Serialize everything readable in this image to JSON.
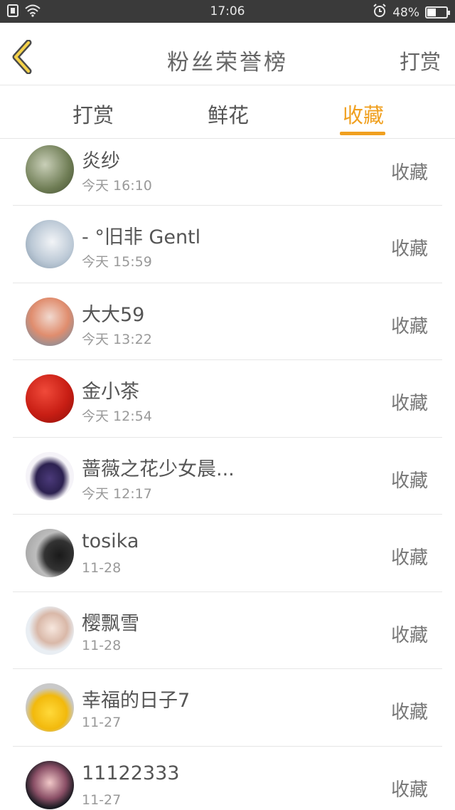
{
  "status_bar": {
    "time": "17:06",
    "battery": "48%",
    "battery_level": 0.48
  },
  "header": {
    "title": "粉丝荣誉榜",
    "action": "打赏"
  },
  "tabs": [
    {
      "label": "打赏"
    },
    {
      "label": "鲜花"
    },
    {
      "label": "收藏"
    }
  ],
  "list": [
    {
      "name": "炎纱",
      "time": "今天 16:10",
      "tag": "收藏"
    },
    {
      "name": "- °旧非 Gentl",
      "time": "今天 15:59",
      "tag": "收藏"
    },
    {
      "name": "大大59",
      "time": "今天 13:22",
      "tag": "收藏"
    },
    {
      "name": "金小茶",
      "time": "今天 12:54",
      "tag": "收藏"
    },
    {
      "name": "蔷薇之花少女晨...",
      "time": "今天 12:17",
      "tag": "收藏"
    },
    {
      "name": "tosika",
      "time": "11-28",
      "tag": "收藏"
    },
    {
      "name": "樱飘雪",
      "time": "11-28",
      "tag": "收藏"
    },
    {
      "name": "幸福的日子7",
      "time": "11-27",
      "tag": "收藏"
    },
    {
      "name": "11122333",
      "time": "11-27",
      "tag": "收藏"
    }
  ]
}
